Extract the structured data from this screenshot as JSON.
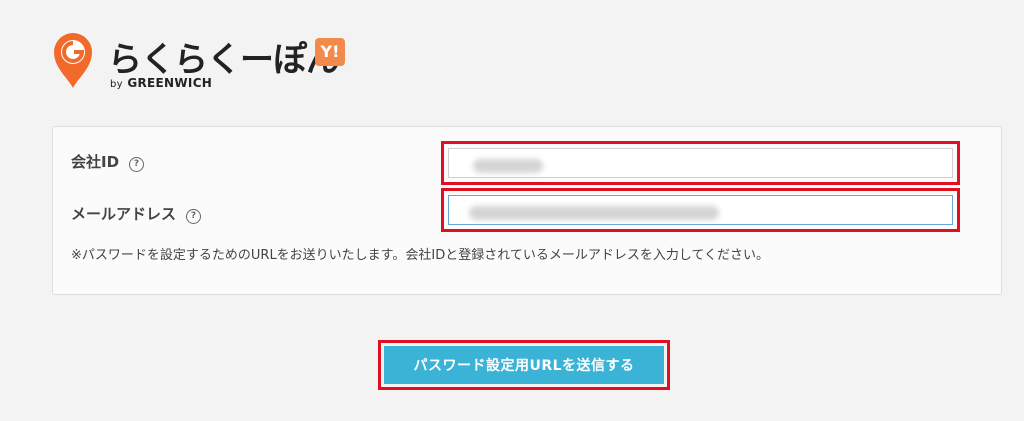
{
  "header": {
    "brand": "らくらくーぽん",
    "yahoo_badge": "Y!",
    "by_prefix": "by",
    "by_name": "GREENWICH"
  },
  "form": {
    "company_id_label": "会社ID",
    "email_label": "メールアドレス",
    "help_glyph": "?",
    "note": "※パスワードを設定するためのURLをお送りいたします。会社IDと登録されているメールアドレスを入力してください。"
  },
  "submit": {
    "label": "パスワード設定用URLを送信する"
  },
  "colors": {
    "accent": "#3bb3d6",
    "highlight": "#e01020",
    "logo_orange": "#f26a2a"
  }
}
